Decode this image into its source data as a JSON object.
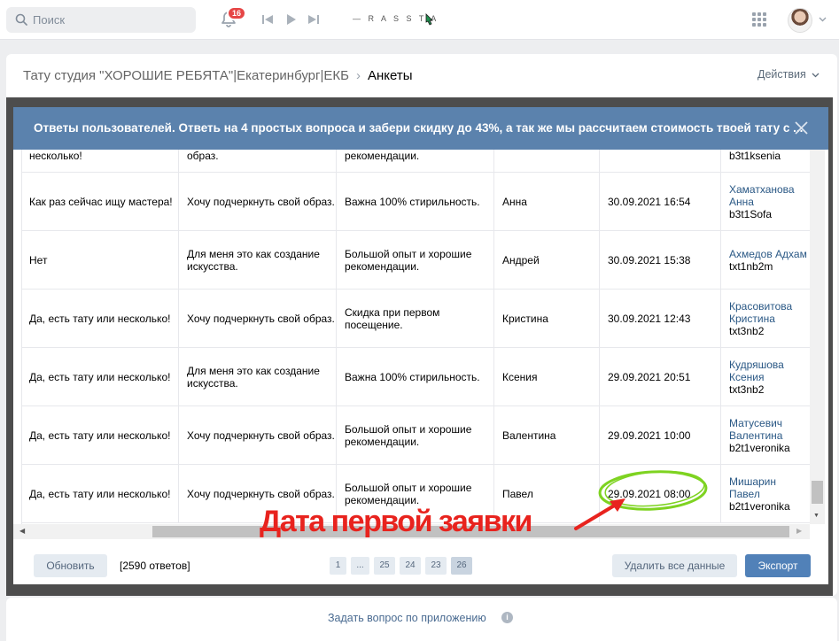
{
  "topbar": {
    "search_placeholder": "Поиск",
    "notifications_count": "16",
    "player_title": "— R A S S T A"
  },
  "breadcrumb": {
    "app": "Тату студия \"ХОРОШИЕ РЕБЯТА\"|Екатеринбург|ЕКБ",
    "current": "Анкеты"
  },
  "actions_label": "Действия",
  "modal": {
    "title": "Ответы пользователей. Ответь на 4 простых вопроса и забери скидку до 43%, а так же мы рассчитаем стоимость твоей тату с ..."
  },
  "table": {
    "rows": [
      {
        "c0": "несколько!",
        "c1": "образ.",
        "c2": "рекомендации.",
        "c3": "",
        "c4": "",
        "author_name": "",
        "author_id": "b3t1ksenia"
      },
      {
        "c0": "Как раз сейчас ищу мастера!",
        "c1": "Хочу подчеркнуть свой образ.",
        "c2": "Важна 100% стирильность.",
        "c3": "Анна",
        "c4": "30.09.2021 16:54",
        "author_name": "Хаматханова Анна",
        "author_id": "b3t1Sofa"
      },
      {
        "c0": "Нет",
        "c1": "Для меня это как создание искусства.",
        "c2": "Большой опыт и хорошие рекомендации.",
        "c3": "Андрей",
        "c4": "30.09.2021 15:38",
        "author_name": "Ахмедов Адхам",
        "author_id": "txt1nb2m"
      },
      {
        "c0": "Да, есть тату или несколько!",
        "c1": "Хочу подчеркнуть свой образ.",
        "c2": "Скидка при первом посещение.",
        "c3": "Кристина",
        "c4": "30.09.2021 12:43",
        "author_name": "Красовитова Кристина",
        "author_id": "txt3nb2"
      },
      {
        "c0": "Да, есть тату или несколько!",
        "c1": "Для меня это как создание искусства.",
        "c2": "Важна 100% стирильность.",
        "c3": "Ксения",
        "c4": "29.09.2021 20:51",
        "author_name": "Кудряшова Ксения",
        "author_id": "txt3nb2"
      },
      {
        "c0": "Да, есть тату или несколько!",
        "c1": "Хочу подчеркнуть свой образ.",
        "c2": "Большой опыт и хорошие рекомендации.",
        "c3": "Валентина",
        "c4": "29.09.2021 10:00",
        "author_name": "Матусевич Валентина",
        "author_id": "b2t1veronika"
      },
      {
        "c0": "Да, есть тату или несколько!",
        "c1": "Хочу подчеркнуть свой образ.",
        "c2": "Большой опыт и хорошие рекомендации.",
        "c3": "Павел",
        "c4": "29.09.2021 08:00",
        "author_name": "Мишарин Павел",
        "author_id": "b2t1veronika"
      }
    ]
  },
  "footer": {
    "refresh_label": "Обновить",
    "count_label": "[2590 ответов]",
    "pages": [
      "1",
      "...",
      "25",
      "24",
      "23",
      "26"
    ],
    "delete_label": "Удалить все данные",
    "export_label": "Экспорт"
  },
  "annotation": "Дата первой заявки",
  "bottom": {
    "ask_label": "Задать вопрос по приложению",
    "info_glyph": "i"
  },
  "colors": {
    "header_blue": "#5b82ad",
    "export_blue": "#5181b8",
    "annotation_red": "#e8231e",
    "highlight_green": "#7ed321",
    "link_blue": "#2a5885"
  }
}
